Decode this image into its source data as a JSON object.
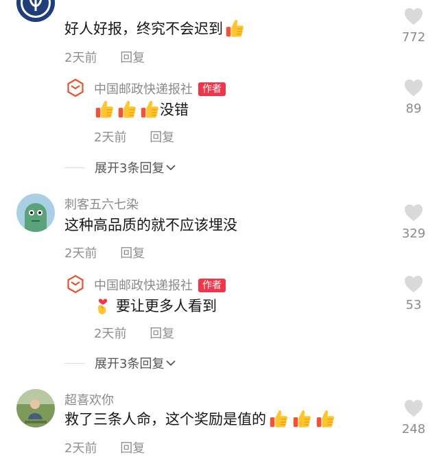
{
  "comments": [
    {
      "username": "",
      "text": "好人好报，终究不会迟到",
      "emoji": [
        "thumbs-up"
      ],
      "time": "2天前",
      "reply_label": "回复",
      "likes": "772",
      "replies": [
        {
          "username": "中国邮政快递报社",
          "badge": "作者",
          "emoji": [
            "thumbs-up",
            "thumbs-up",
            "thumbs-up"
          ],
          "text": "没错",
          "time": "2天前",
          "reply_label": "回复",
          "likes": "89"
        }
      ],
      "expand_label": "展开3条回复"
    },
    {
      "username": "刺客五六七染",
      "text": "这种高品质的就不应该埋没",
      "time": "2天前",
      "reply_label": "回复",
      "likes": "329",
      "replies": [
        {
          "username": "中国邮政快递报社",
          "badge": "作者",
          "emoji": [
            "finger-heart"
          ],
          "text": "要让更多人看到",
          "time": "2天前",
          "reply_label": "回复",
          "likes": "53"
        }
      ],
      "expand_label": "展开3条回复"
    },
    {
      "username": "超喜欢你",
      "text": "救了三条人命，这个奖励是值的",
      "emoji": [
        "thumbs-up",
        "thumbs-up",
        "thumbs-up"
      ],
      "time": "2天前",
      "reply_label": "回复",
      "likes": "248"
    }
  ],
  "colors": {
    "badge": "#f0364a",
    "meta": "#8f8f8f",
    "heart": "#d8d8d8",
    "postal_orange": "#e8502a"
  }
}
